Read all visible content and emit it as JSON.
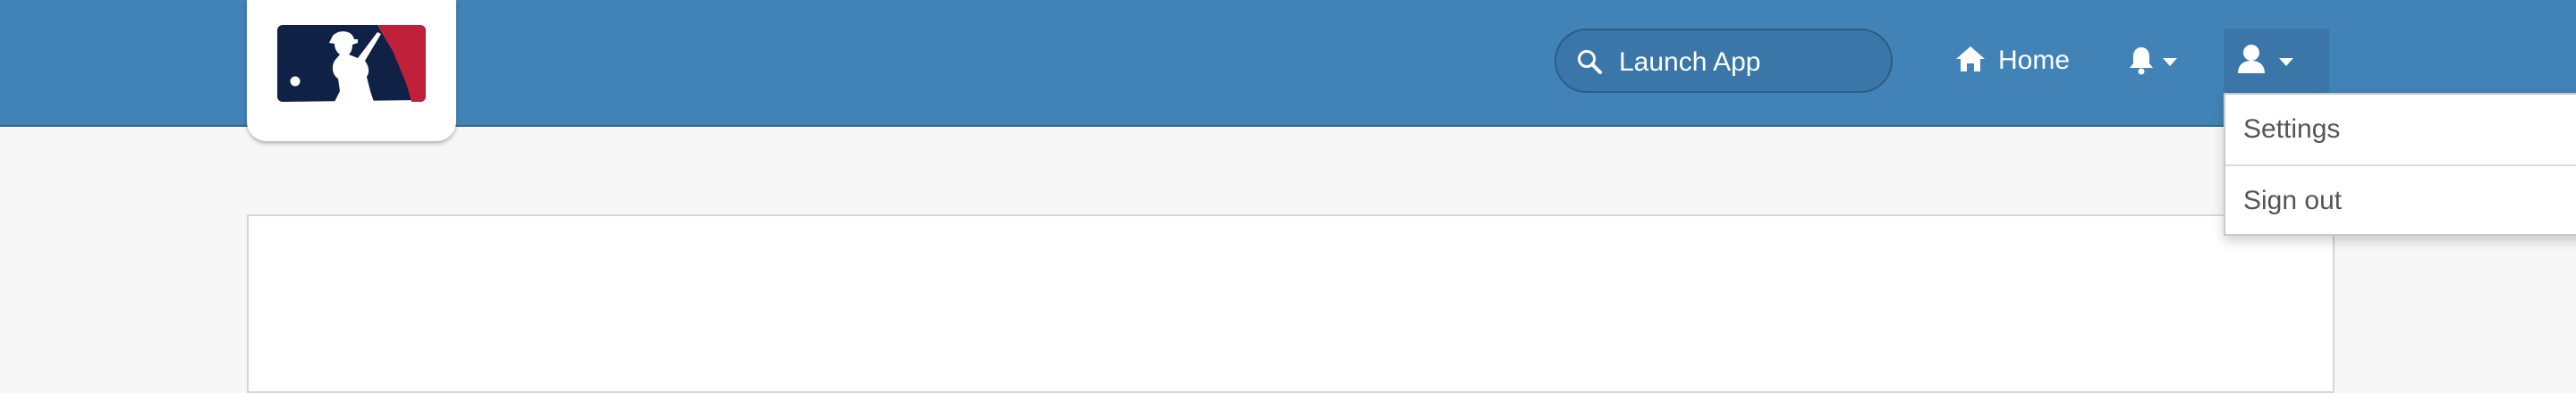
{
  "header": {
    "logo_name": "mlb-logo",
    "search": {
      "label": "Launch App"
    },
    "nav": {
      "home_label": "Home",
      "notifications_icon": "bell-icon",
      "user_icon": "user-icon"
    },
    "user_menu": {
      "items": [
        "Settings",
        "Sign out"
      ]
    }
  },
  "colors": {
    "topbar": "#4183b7",
    "logo_navy": "#0f2145",
    "logo_red": "#c1203b",
    "page_bg": "#f7f7f7"
  }
}
